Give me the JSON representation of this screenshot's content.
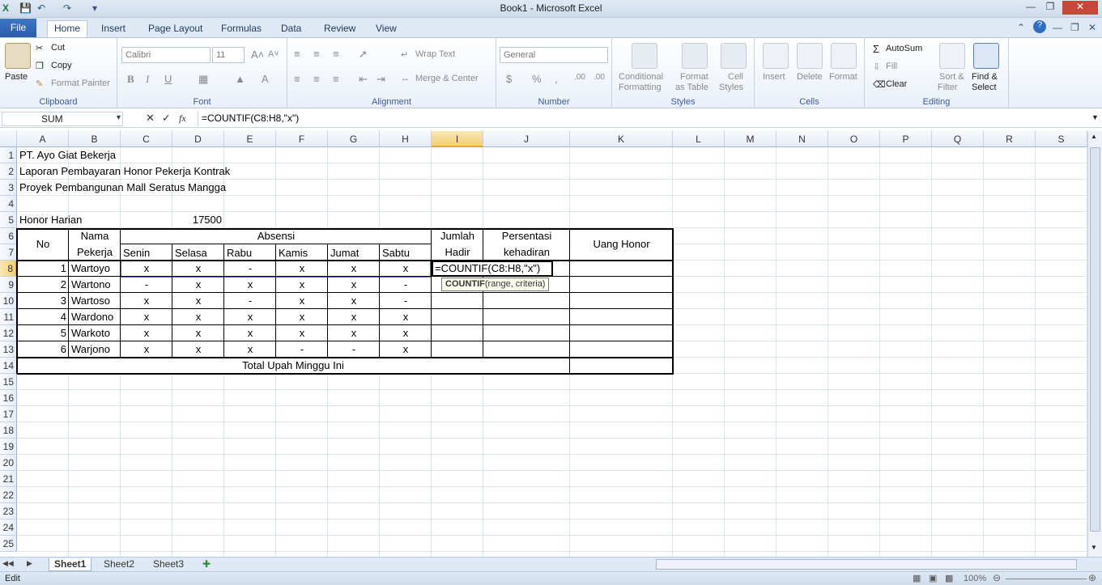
{
  "window": {
    "title": "Book1  -  Microsoft Excel"
  },
  "tabs": [
    "File",
    "Home",
    "Insert",
    "Page Layout",
    "Formulas",
    "Data",
    "Review",
    "View"
  ],
  "ribbon": {
    "clipboard": {
      "paste": "Paste",
      "cut": "Cut",
      "copy": "Copy",
      "format_painter": "Format Painter",
      "label": "Clipboard"
    },
    "font": {
      "font_name": "Calibri",
      "font_size": "11",
      "label": "Font"
    },
    "alignment": {
      "wrap_text": "Wrap Text",
      "merge_center": "Merge & Center",
      "label": "Alignment"
    },
    "number": {
      "format": "General",
      "label": "Number"
    },
    "styles": {
      "conditional_1": "Conditional",
      "conditional_2": "Formatting",
      "format_table_1": "Format",
      "format_table_2": "as Table",
      "cell_styles_1": "Cell",
      "cell_styles_2": "Styles",
      "label": "Styles"
    },
    "cells": {
      "insert": "Insert",
      "delete": "Delete",
      "format": "Format",
      "label": "Cells"
    },
    "editing": {
      "autosum": "AutoSum",
      "fill": "Fill",
      "clear": "Clear",
      "sort_1": "Sort &",
      "sort_2": "Filter",
      "find_1": "Find &",
      "find_2": "Select",
      "label": "Editing"
    }
  },
  "formula_bar": {
    "name_box": "SUM",
    "formula": "=COUNTIF(C8:H8,\"x\")"
  },
  "columns": [
    "A",
    "B",
    "C",
    "D",
    "E",
    "F",
    "G",
    "H",
    "I",
    "J",
    "K",
    "L",
    "M",
    "N",
    "O",
    "P",
    "Q",
    "R",
    "S"
  ],
  "rows": [
    "1",
    "2",
    "3",
    "4",
    "5",
    "6",
    "7",
    "8",
    "9",
    "10",
    "11",
    "12",
    "13",
    "14",
    "15",
    "16",
    "17",
    "18",
    "19",
    "20",
    "21",
    "22",
    "23",
    "24",
    "25"
  ],
  "sheet": {
    "a1": "PT. Ayo Giat Bekerja",
    "a2": "Laporan Pembayaran Honor Pekerja Kontrak",
    "a3": "Proyek Pembangunan Mall Seratus Mangga",
    "a5": "Honor Harian",
    "d5": "17500",
    "hdr_no": "No",
    "hdr_nama_1": "Nama",
    "hdr_nama_2": "Pekerja",
    "hdr_absensi": "Absensi",
    "hdr_jumlah_1": "Jumlah",
    "hdr_jumlah_2": "Hadir",
    "hdr_persen_1": "Persentasi",
    "hdr_persen_2": "kehadiran",
    "hdr_uang": "Uang Honor",
    "days": [
      "Senin",
      "Selasa",
      "Rabu",
      "Kamis",
      "Jumat",
      "Sabtu"
    ],
    "total_label": "Total Upah Minggu Ini",
    "editing_cell": "=COUNTIF(C8:H8,\"x\")",
    "tooltip_fn": "COUNTIF",
    "tooltip_args": "(range, criteria)",
    "workers": [
      {
        "no": "1",
        "name": "Wartoyo",
        "att": [
          "x",
          "x",
          "-",
          "x",
          "x",
          "x"
        ]
      },
      {
        "no": "2",
        "name": "Wartono",
        "att": [
          "-",
          "x",
          "x",
          "x",
          "x",
          "-"
        ]
      },
      {
        "no": "3",
        "name": "Wartoso",
        "att": [
          "x",
          "x",
          "-",
          "x",
          "x",
          "-"
        ]
      },
      {
        "no": "4",
        "name": "Wardono",
        "att": [
          "x",
          "x",
          "x",
          "x",
          "x",
          "x"
        ]
      },
      {
        "no": "5",
        "name": "Warkoto",
        "att": [
          "x",
          "x",
          "x",
          "x",
          "x",
          "x"
        ]
      },
      {
        "no": "6",
        "name": "Warjono",
        "att": [
          "x",
          "x",
          "x",
          "-",
          "-",
          "x"
        ]
      }
    ]
  },
  "sheet_tabs": [
    "Sheet1",
    "Sheet2",
    "Sheet3"
  ],
  "status": {
    "mode": "Edit",
    "zoom": "100%"
  }
}
